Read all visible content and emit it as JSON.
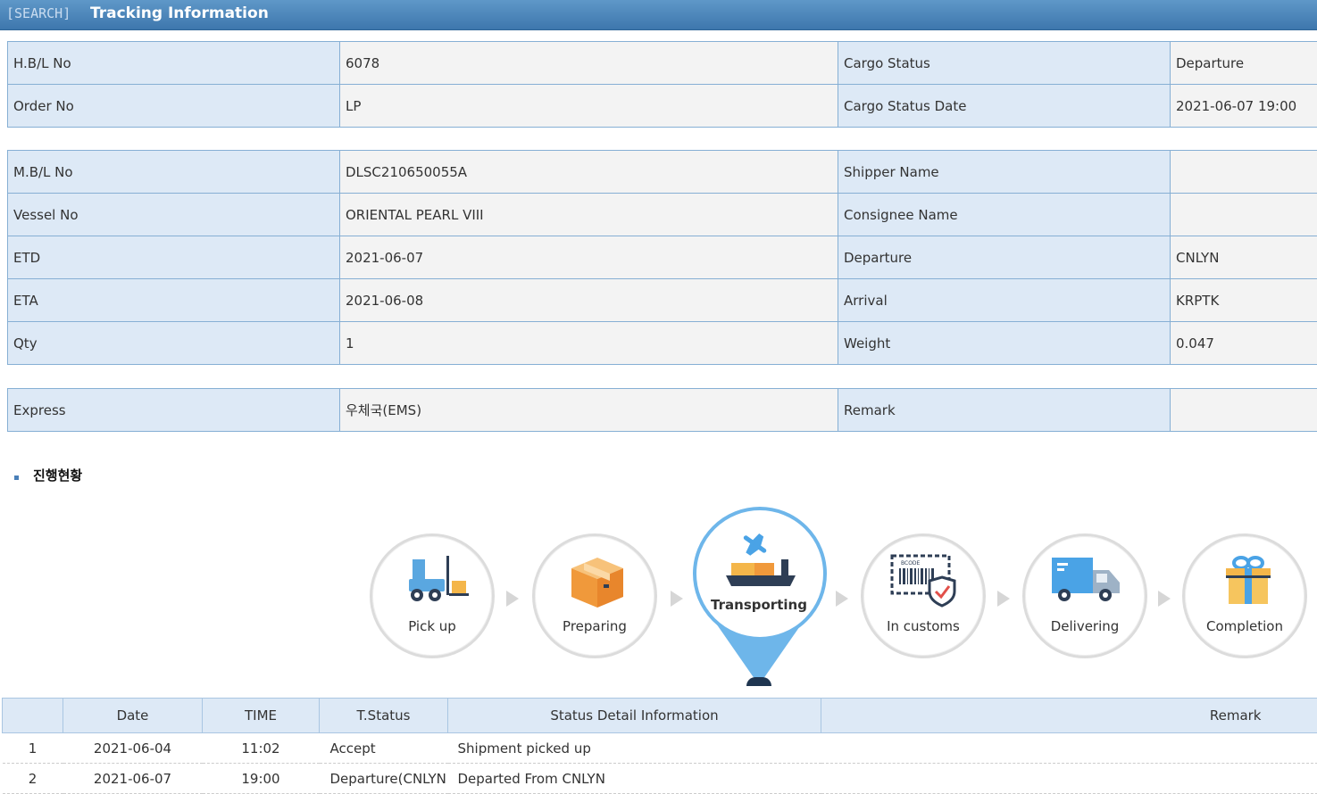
{
  "header": {
    "tag": "[SEARCH]",
    "title": "Tracking Information"
  },
  "table1": [
    {
      "l1": "H.B/L No",
      "v1": "6078",
      "l2": "Cargo Status",
      "v2": "Departure"
    },
    {
      "l1": "Order No",
      "v1": "LP",
      "l2": "Cargo Status Date",
      "v2": "2021-06-07 19:00"
    }
  ],
  "table2": [
    {
      "l1": "M.B/L No",
      "v1": "DLSC210650055A",
      "l2": "Shipper Name",
      "v2": ""
    },
    {
      "l1": "Vessel No",
      "v1": "ORIENTAL PEARL VIII",
      "l2": "Consignee Name",
      "v2": ""
    },
    {
      "l1": "ETD",
      "v1": "2021-06-07",
      "l2": "Departure",
      "v2": "CNLYN"
    },
    {
      "l1": "ETA",
      "v1": "2021-06-08",
      "l2": "Arrival",
      "v2": "KRPTK"
    },
    {
      "l1": "Qty",
      "v1": "1",
      "l2": "Weight",
      "v2": "0.047"
    }
  ],
  "table3": [
    {
      "l1": "Express",
      "v1": "우체국(EMS)",
      "l2": "Remark",
      "v2": ""
    }
  ],
  "progress": {
    "title": "진행현황",
    "steps": [
      "Pick up",
      "Preparing",
      "Transporting",
      "In customs",
      "Delivering",
      "Completion"
    ],
    "active": "Transporting",
    "customs_icon_text": "BCODE"
  },
  "history": {
    "headers": [
      "",
      "Date",
      "TIME",
      "T.Status",
      "Status Detail Information",
      "Remark"
    ],
    "rows": [
      [
        "1",
        "2021-06-04",
        "11:02",
        "Accept",
        "Shipment picked up",
        ""
      ],
      [
        "2",
        "2021-06-07",
        "19:00",
        "Departure(CNLYN",
        "Departed From CNLYN",
        ""
      ]
    ]
  },
  "colors": {
    "header": "#4a84ba",
    "label_bg": "#dde9f6",
    "value_bg": "#f3f3f3",
    "active": "#6eb6ea"
  }
}
